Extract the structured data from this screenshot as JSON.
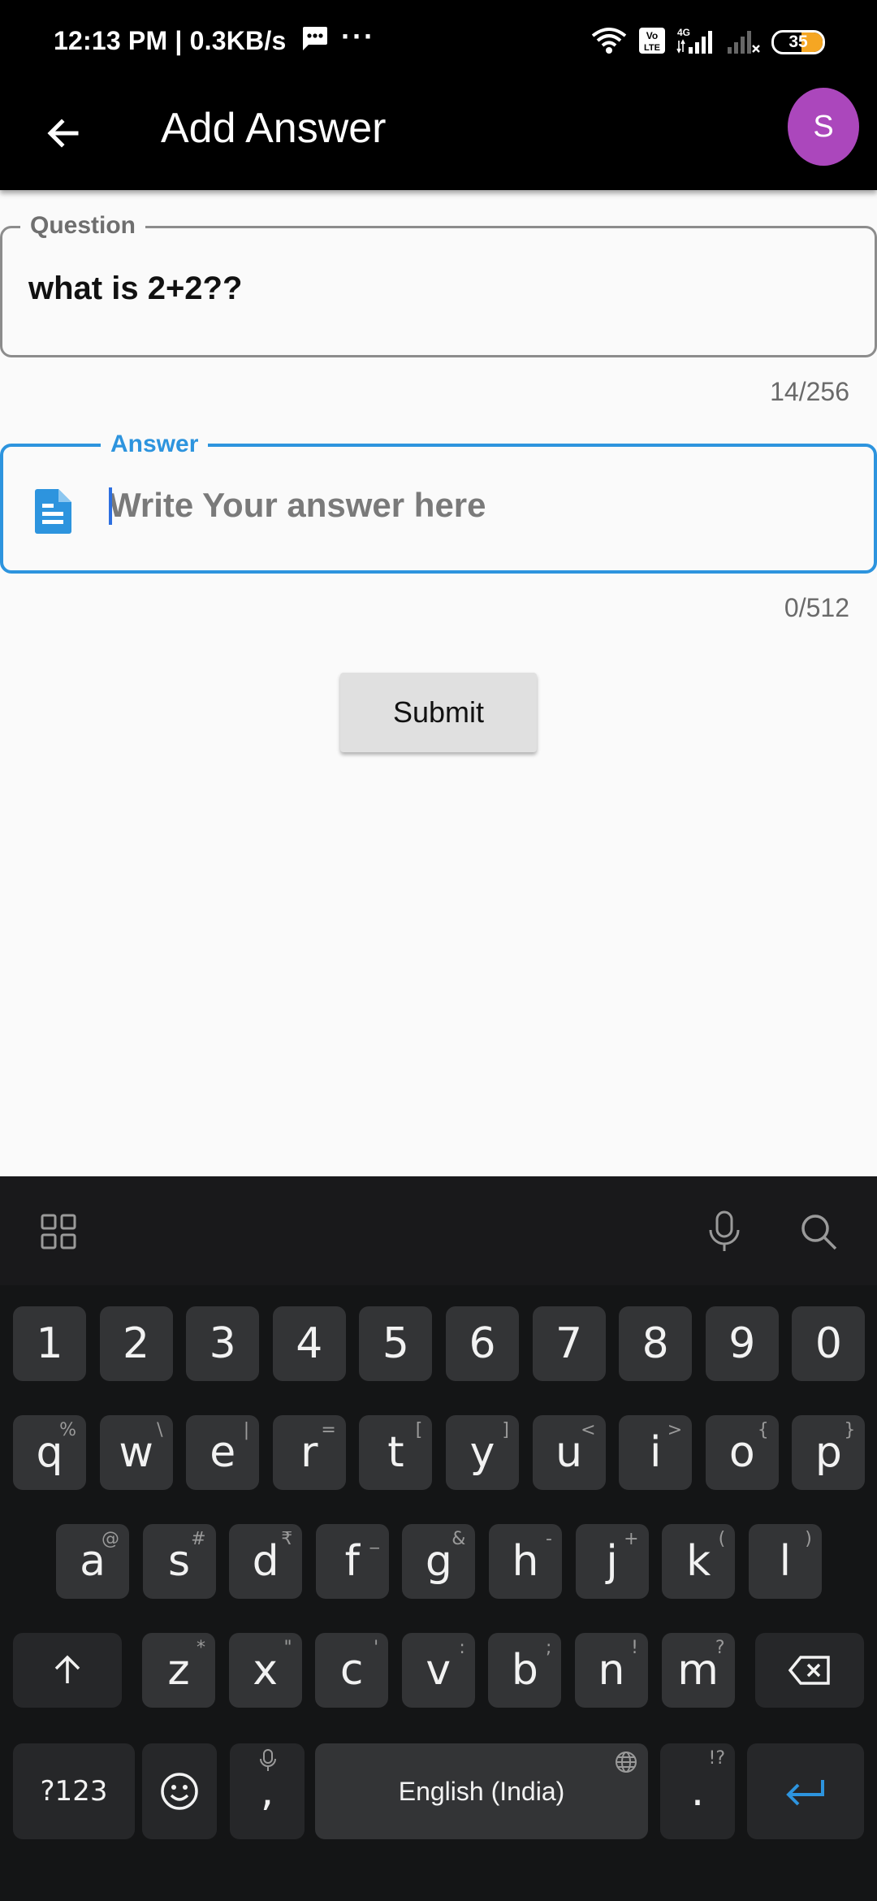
{
  "status_bar": {
    "time_and_speed": "12:13 PM | 0.3KB/s",
    "dots": "···",
    "signal_label": "4G",
    "volte_label": "Vo LTE",
    "battery_level": "35"
  },
  "app_bar": {
    "title": "Add Answer",
    "avatar_initial": "S"
  },
  "question_field": {
    "label": "Question",
    "value": "what is 2+2??",
    "counter": "14/256"
  },
  "answer_field": {
    "label": "Answer",
    "placeholder": "Write Your answer here",
    "value": "",
    "counter": "0/512"
  },
  "submit_label": "Submit",
  "keyboard": {
    "number_row": [
      "1",
      "2",
      "3",
      "4",
      "5",
      "6",
      "7",
      "8",
      "9",
      "0"
    ],
    "row1": [
      {
        "key": "q",
        "sup": "%"
      },
      {
        "key": "w",
        "sup": "\\"
      },
      {
        "key": "e",
        "sup": "|"
      },
      {
        "key": "r",
        "sup": "="
      },
      {
        "key": "t",
        "sup": "["
      },
      {
        "key": "y",
        "sup": "]"
      },
      {
        "key": "u",
        "sup": "<"
      },
      {
        "key": "i",
        "sup": ">"
      },
      {
        "key": "o",
        "sup": "{"
      },
      {
        "key": "p",
        "sup": "}"
      }
    ],
    "row2": [
      {
        "key": "a",
        "sup": "@"
      },
      {
        "key": "s",
        "sup": "#"
      },
      {
        "key": "d",
        "sup": "₹"
      },
      {
        "key": "f",
        "sup": "_"
      },
      {
        "key": "g",
        "sup": "&"
      },
      {
        "key": "h",
        "sup": "-"
      },
      {
        "key": "j",
        "sup": "+"
      },
      {
        "key": "k",
        "sup": "("
      },
      {
        "key": "l",
        "sup": ")"
      }
    ],
    "row3": [
      {
        "key": "z",
        "sup": "*"
      },
      {
        "key": "x",
        "sup": "\""
      },
      {
        "key": "c",
        "sup": "'"
      },
      {
        "key": "v",
        "sup": ":"
      },
      {
        "key": "b",
        "sup": ";"
      },
      {
        "key": "n",
        "sup": "!"
      },
      {
        "key": "m",
        "sup": "?"
      }
    ],
    "symbols_label": "?123",
    "comma_label": ",",
    "space_label": "English (India)",
    "period_label": ".",
    "period_sup": "!?"
  },
  "colors": {
    "accent": "#2d94de",
    "avatar": "#ab47bc",
    "battery_fill": "#f5a623"
  }
}
